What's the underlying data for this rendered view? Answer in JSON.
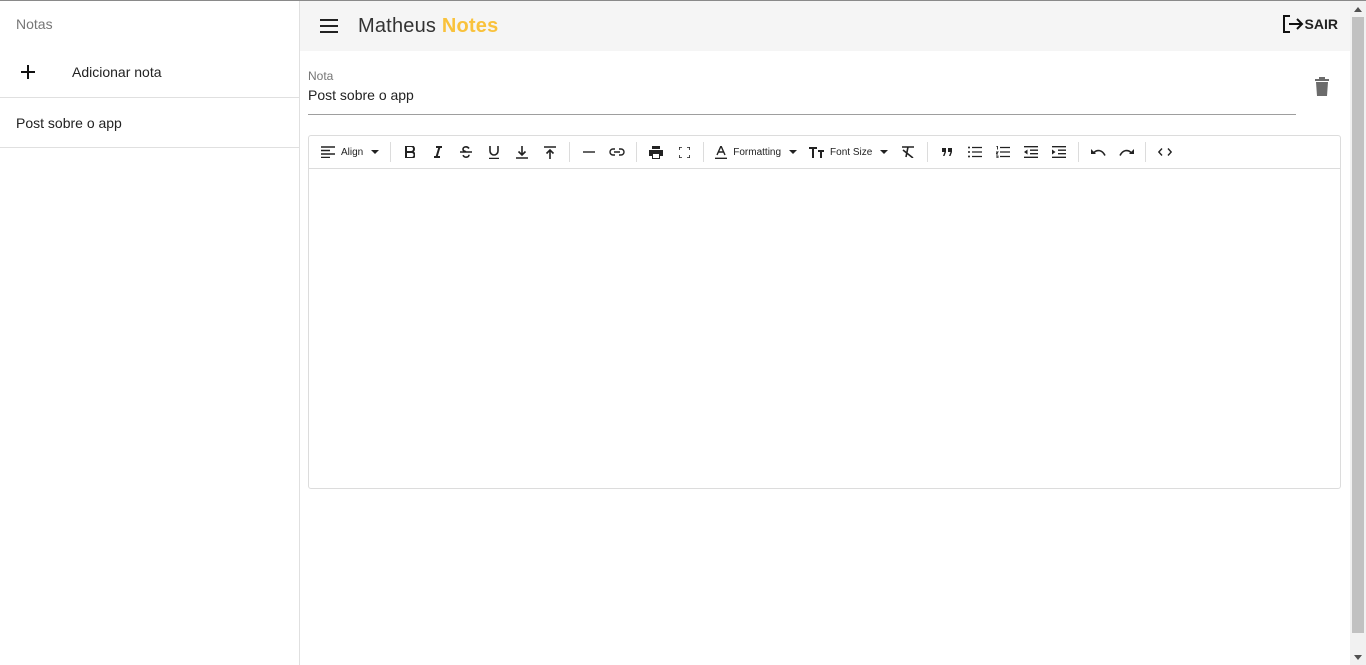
{
  "sidebar": {
    "title": "Notas",
    "add_label": "Adicionar nota",
    "notes": [
      {
        "label": "Post sobre o app"
      }
    ]
  },
  "appbar": {
    "brand_name": "Matheus",
    "brand_accent": "Notes",
    "logout_label": "SAIR"
  },
  "note_field": {
    "label": "Nota",
    "value": "Post sobre o app"
  },
  "toolbar": {
    "align_label": "Align",
    "formatting_label": "Formatting",
    "font_size_label": "Font Size"
  },
  "colors": {
    "accent": "#f9c23c",
    "appbar_bg": "#f5f5f5"
  },
  "icons": [
    "plus-icon",
    "menu-icon",
    "logout-icon",
    "trash-icon",
    "align-left-icon",
    "bold-icon",
    "italic-icon",
    "strikethrough-icon",
    "underline-icon",
    "subscript-icon",
    "superscript-icon",
    "horizontal-rule-icon",
    "link-icon",
    "print-icon",
    "fullscreen-icon",
    "text-color-icon",
    "font-size-icon",
    "clear-format-icon",
    "quote-icon",
    "bullet-list-icon",
    "numbered-list-icon",
    "outdent-icon",
    "indent-icon",
    "undo-icon",
    "redo-icon",
    "code-view-icon"
  ]
}
